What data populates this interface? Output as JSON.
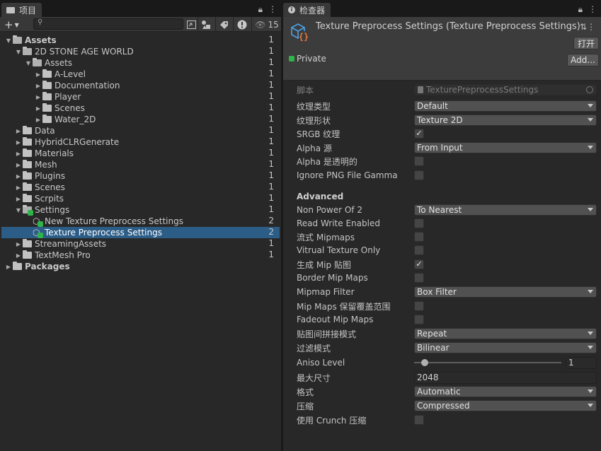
{
  "project": {
    "tab_label": "项目",
    "search_placeholder": "",
    "visible_count": "15",
    "tree": [
      {
        "label": "Assets",
        "count": "1",
        "level": 0,
        "expanded": true,
        "bold": true,
        "kind": "folder"
      },
      {
        "label": "2D STONE AGE WORLD",
        "count": "1",
        "level": 1,
        "expanded": true,
        "kind": "folder"
      },
      {
        "label": "Assets",
        "count": "1",
        "level": 2,
        "expanded": true,
        "kind": "folder"
      },
      {
        "label": "A-Level",
        "count": "1",
        "level": 3,
        "expanded": false,
        "kind": "folder"
      },
      {
        "label": "Documentation",
        "count": "1",
        "level": 3,
        "expanded": false,
        "kind": "folder"
      },
      {
        "label": "Player",
        "count": "1",
        "level": 3,
        "expanded": false,
        "kind": "folder"
      },
      {
        "label": "Scenes",
        "count": "1",
        "level": 3,
        "expanded": false,
        "kind": "folder"
      },
      {
        "label": "Water_2D",
        "count": "1",
        "level": 3,
        "expanded": false,
        "kind": "folder"
      },
      {
        "label": "Data",
        "count": "1",
        "level": 1,
        "expanded": false,
        "kind": "folder"
      },
      {
        "label": "HybridCLRGenerate",
        "count": "1",
        "level": 1,
        "expanded": false,
        "kind": "folder"
      },
      {
        "label": "Materials",
        "count": "1",
        "level": 1,
        "expanded": false,
        "kind": "folder"
      },
      {
        "label": "Mesh",
        "count": "1",
        "level": 1,
        "expanded": false,
        "kind": "folder"
      },
      {
        "label": "Plugins",
        "count": "1",
        "level": 1,
        "expanded": false,
        "kind": "folder"
      },
      {
        "label": "Scenes",
        "count": "1",
        "level": 1,
        "expanded": false,
        "kind": "folder"
      },
      {
        "label": "Scrpits",
        "count": "1",
        "level": 1,
        "expanded": false,
        "kind": "folder"
      },
      {
        "label": "Settings",
        "count": "1",
        "level": 1,
        "expanded": true,
        "kind": "folder-badge"
      },
      {
        "label": "New Texture Preprocess Settings",
        "count": "2",
        "level": 2,
        "kind": "asset"
      },
      {
        "label": "Texture Preprocess Settings",
        "count": "2",
        "level": 2,
        "kind": "asset",
        "selected": true
      },
      {
        "label": "StreamingAssets",
        "count": "1",
        "level": 1,
        "expanded": false,
        "kind": "folder"
      },
      {
        "label": "TextMesh Pro",
        "count": "1",
        "level": 1,
        "expanded": false,
        "kind": "folder"
      },
      {
        "label": "Packages",
        "count": "",
        "level": 0,
        "expanded": false,
        "bold": true,
        "kind": "folder"
      }
    ]
  },
  "inspector": {
    "tab_label": "检查器",
    "title": "Texture Preprocess Settings (Texture Preprocess Settings)",
    "open_button": "打开",
    "private_label": "Private",
    "add_button": "Add...",
    "script_label": "脚本",
    "script_value": "TexturePreprocessSettings",
    "props": [
      {
        "label": "纹理类型",
        "type": "dropdown",
        "value": "Default"
      },
      {
        "label": "纹理形状",
        "type": "dropdown",
        "value": "Texture 2D"
      },
      {
        "label": "SRGB 纹理",
        "type": "check",
        "value": "✓"
      },
      {
        "label": "Alpha 源",
        "type": "dropdown",
        "value": "From Input"
      },
      {
        "label": "Alpha 是透明的",
        "type": "check",
        "value": ""
      },
      {
        "label": "Ignore PNG File Gamma",
        "type": "check",
        "value": ""
      },
      {
        "label": "Advanced",
        "type": "section",
        "value": ""
      },
      {
        "label": "Non Power Of 2",
        "type": "dropdown",
        "value": "To Nearest"
      },
      {
        "label": "Read Write Enabled",
        "type": "check",
        "value": ""
      },
      {
        "label": "流式 Mipmaps",
        "type": "check",
        "value": ""
      },
      {
        "label": "Vitrual Texture Only",
        "type": "check",
        "value": ""
      },
      {
        "label": "生成 Mip 贴图",
        "type": "check",
        "value": "✓"
      },
      {
        "label": "Border Mip Maps",
        "type": "check",
        "value": ""
      },
      {
        "label": "Mipmap Filter",
        "type": "dropdown",
        "value": "Box Filter"
      },
      {
        "label": "Mip Maps 保留覆盖范围",
        "type": "check",
        "value": ""
      },
      {
        "label": "Fadeout Mip Maps",
        "type": "check",
        "value": ""
      },
      {
        "label": "贴图间拼接模式",
        "type": "dropdown",
        "value": "Repeat"
      },
      {
        "label": "过滤模式",
        "type": "dropdown",
        "value": "Bilinear"
      },
      {
        "label": "Aniso Level",
        "type": "slider",
        "value": "1"
      },
      {
        "label": "最大尺寸",
        "type": "text",
        "value": "2048"
      },
      {
        "label": "格式",
        "type": "dropdown",
        "value": "Automatic"
      },
      {
        "label": "压缩",
        "type": "dropdown",
        "value": "Compressed"
      },
      {
        "label": "使用 Crunch 压缩",
        "type": "check",
        "value": ""
      }
    ]
  }
}
